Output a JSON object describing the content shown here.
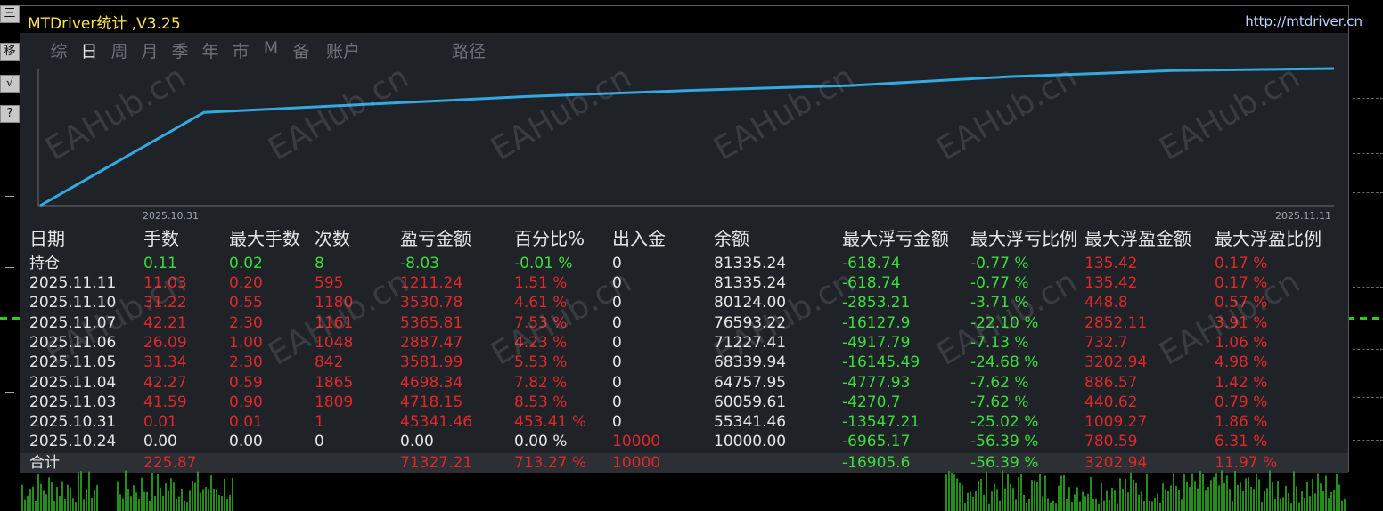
{
  "window": {
    "title": "MTDriver统计 ,V3.25",
    "url": "http://mtdriver.cn",
    "tabs": [
      "综",
      "日",
      "周",
      "月",
      "季",
      "年",
      "市",
      "M",
      "备",
      "账户"
    ],
    "active_tab": "日",
    "path_label": "路径"
  },
  "side_buttons": [
    "三",
    "移",
    "√",
    "?"
  ],
  "chart_data": {
    "type": "line",
    "x": [
      "2025.10.24",
      "2025.10.31",
      "2025.11.03",
      "2025.11.04",
      "2025.11.05",
      "2025.11.06",
      "2025.11.07",
      "2025.11.10",
      "2025.11.11"
    ],
    "values": [
      10000.0,
      55341.46,
      60059.61,
      64757.95,
      68339.94,
      71227.41,
      76593.22,
      80124.0,
      81335.24
    ],
    "x_tick_labels": [
      "2025.10.31",
      "2025.11.11"
    ],
    "line_color": "#34a8e0",
    "grid": false
  },
  "table": {
    "headers": [
      "日期",
      "手数",
      "最大手数",
      "次数",
      "盈亏金额",
      "百分比%",
      "出入金",
      "余额",
      "最大浮亏金额",
      "最大浮亏比例",
      "最大浮盈金额",
      "最大浮盈比例"
    ],
    "position_row": {
      "date": "持仓",
      "lots": "0.11",
      "max_lots": "0.02",
      "count": "8",
      "pnl": "-8.03",
      "pct": "-0.01 %",
      "deposit": "0",
      "balance": "81335.24",
      "max_dd": "-618.74",
      "max_dd_pct": "-0.77 %",
      "max_fp": "135.42",
      "max_fp_pct": "0.17 %"
    },
    "rows": [
      {
        "date": "2025.11.11",
        "lots": "11.03",
        "max_lots": "0.20",
        "count": "595",
        "pnl": "1211.24",
        "pct": "1.51 %",
        "deposit": "0",
        "balance": "81335.24",
        "max_dd": "-618.74",
        "max_dd_pct": "-0.77 %",
        "max_fp": "135.42",
        "max_fp_pct": "0.17 %"
      },
      {
        "date": "2025.11.10",
        "lots": "31.22",
        "max_lots": "0.55",
        "count": "1180",
        "pnl": "3530.78",
        "pct": "4.61 %",
        "deposit": "0",
        "balance": "80124.00",
        "max_dd": "-2853.21",
        "max_dd_pct": "-3.71 %",
        "max_fp": "448.8",
        "max_fp_pct": "0.57 %"
      },
      {
        "date": "2025.11.07",
        "lots": "42.21",
        "max_lots": "2.30",
        "count": "1161",
        "pnl": "5365.81",
        "pct": "7.53 %",
        "deposit": "0",
        "balance": "76593.22",
        "max_dd": "-16127.9",
        "max_dd_pct": "-22.10 %",
        "max_fp": "2852.11",
        "max_fp_pct": "3.91 %"
      },
      {
        "date": "2025.11.06",
        "lots": "26.09",
        "max_lots": "1.00",
        "count": "1048",
        "pnl": "2887.47",
        "pct": "4.23 %",
        "deposit": "0",
        "balance": "71227.41",
        "max_dd": "-4917.79",
        "max_dd_pct": "-7.13 %",
        "max_fp": "732.7",
        "max_fp_pct": "1.06 %"
      },
      {
        "date": "2025.11.05",
        "lots": "31.34",
        "max_lots": "2.30",
        "count": "842",
        "pnl": "3581.99",
        "pct": "5.53 %",
        "deposit": "0",
        "balance": "68339.94",
        "max_dd": "-16145.49",
        "max_dd_pct": "-24.68 %",
        "max_fp": "3202.94",
        "max_fp_pct": "4.98 %"
      },
      {
        "date": "2025.11.04",
        "lots": "42.27",
        "max_lots": "0.59",
        "count": "1865",
        "pnl": "4698.34",
        "pct": "7.82 %",
        "deposit": "0",
        "balance": "64757.95",
        "max_dd": "-4777.93",
        "max_dd_pct": "-7.62 %",
        "max_fp": "886.57",
        "max_fp_pct": "1.42 %"
      },
      {
        "date": "2025.11.03",
        "lots": "41.59",
        "max_lots": "0.90",
        "count": "1809",
        "pnl": "4718.15",
        "pct": "8.53 %",
        "deposit": "0",
        "balance": "60059.61",
        "max_dd": "-4270.7",
        "max_dd_pct": "-7.62 %",
        "max_fp": "440.62",
        "max_fp_pct": "0.79 %"
      },
      {
        "date": "2025.10.31",
        "lots": "0.01",
        "max_lots": "0.01",
        "count": "1",
        "pnl": "45341.46",
        "pct": "453.41 %",
        "deposit": "0",
        "balance": "55341.46",
        "max_dd": "-13547.21",
        "max_dd_pct": "-25.02 %",
        "max_fp": "1009.27",
        "max_fp_pct": "1.86 %"
      },
      {
        "date": "2025.10.24",
        "lots": "0.00",
        "max_lots": "0.00",
        "count": "0",
        "pnl": "0.00",
        "pct": "0.00 %",
        "deposit": "10000",
        "balance": "10000.00",
        "max_dd": "-6965.17",
        "max_dd_pct": "-56.39 %",
        "max_fp": "780.59",
        "max_fp_pct": "6.31 %"
      }
    ],
    "total_row": {
      "date": "合计",
      "lots": "225.87",
      "max_lots": "",
      "count": "",
      "pnl": "71327.21",
      "pct": "713.27 %",
      "deposit": "10000",
      "balance": "",
      "max_dd": "-16905.6",
      "max_dd_pct": "-56.39 %",
      "max_fp": "3202.94",
      "max_fp_pct": "11.97 %"
    }
  },
  "watermark": "EAHub.cn",
  "colors": {
    "title": "#ffe24a",
    "url": "#b9d2ff",
    "header": "#e6e6e6",
    "white": "#e6e6e6",
    "red": "#e0282a",
    "green": "#3cdc3c",
    "chart_line": "#34a8e0"
  }
}
